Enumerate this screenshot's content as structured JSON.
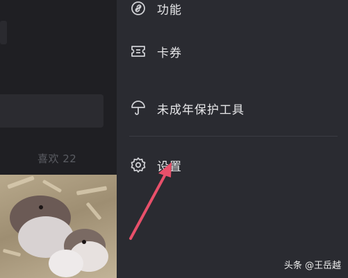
{
  "left_panel": {
    "likes_label": "喜欢 22"
  },
  "menu": {
    "items": [
      {
        "label": "功能",
        "icon": "link-icon"
      },
      {
        "label": "卡券",
        "icon": "ticket-icon"
      },
      {
        "label": "未成年保护工具",
        "icon": "umbrella-icon"
      },
      {
        "label": "设置",
        "icon": "gear-icon"
      }
    ]
  },
  "watermark": {
    "text": "头条 @王岳越"
  },
  "colors": {
    "drawer_bg": "#2a2b31",
    "left_bg": "#1f1f23",
    "arrow": "#e8506a",
    "text": "#e8e8ea"
  }
}
